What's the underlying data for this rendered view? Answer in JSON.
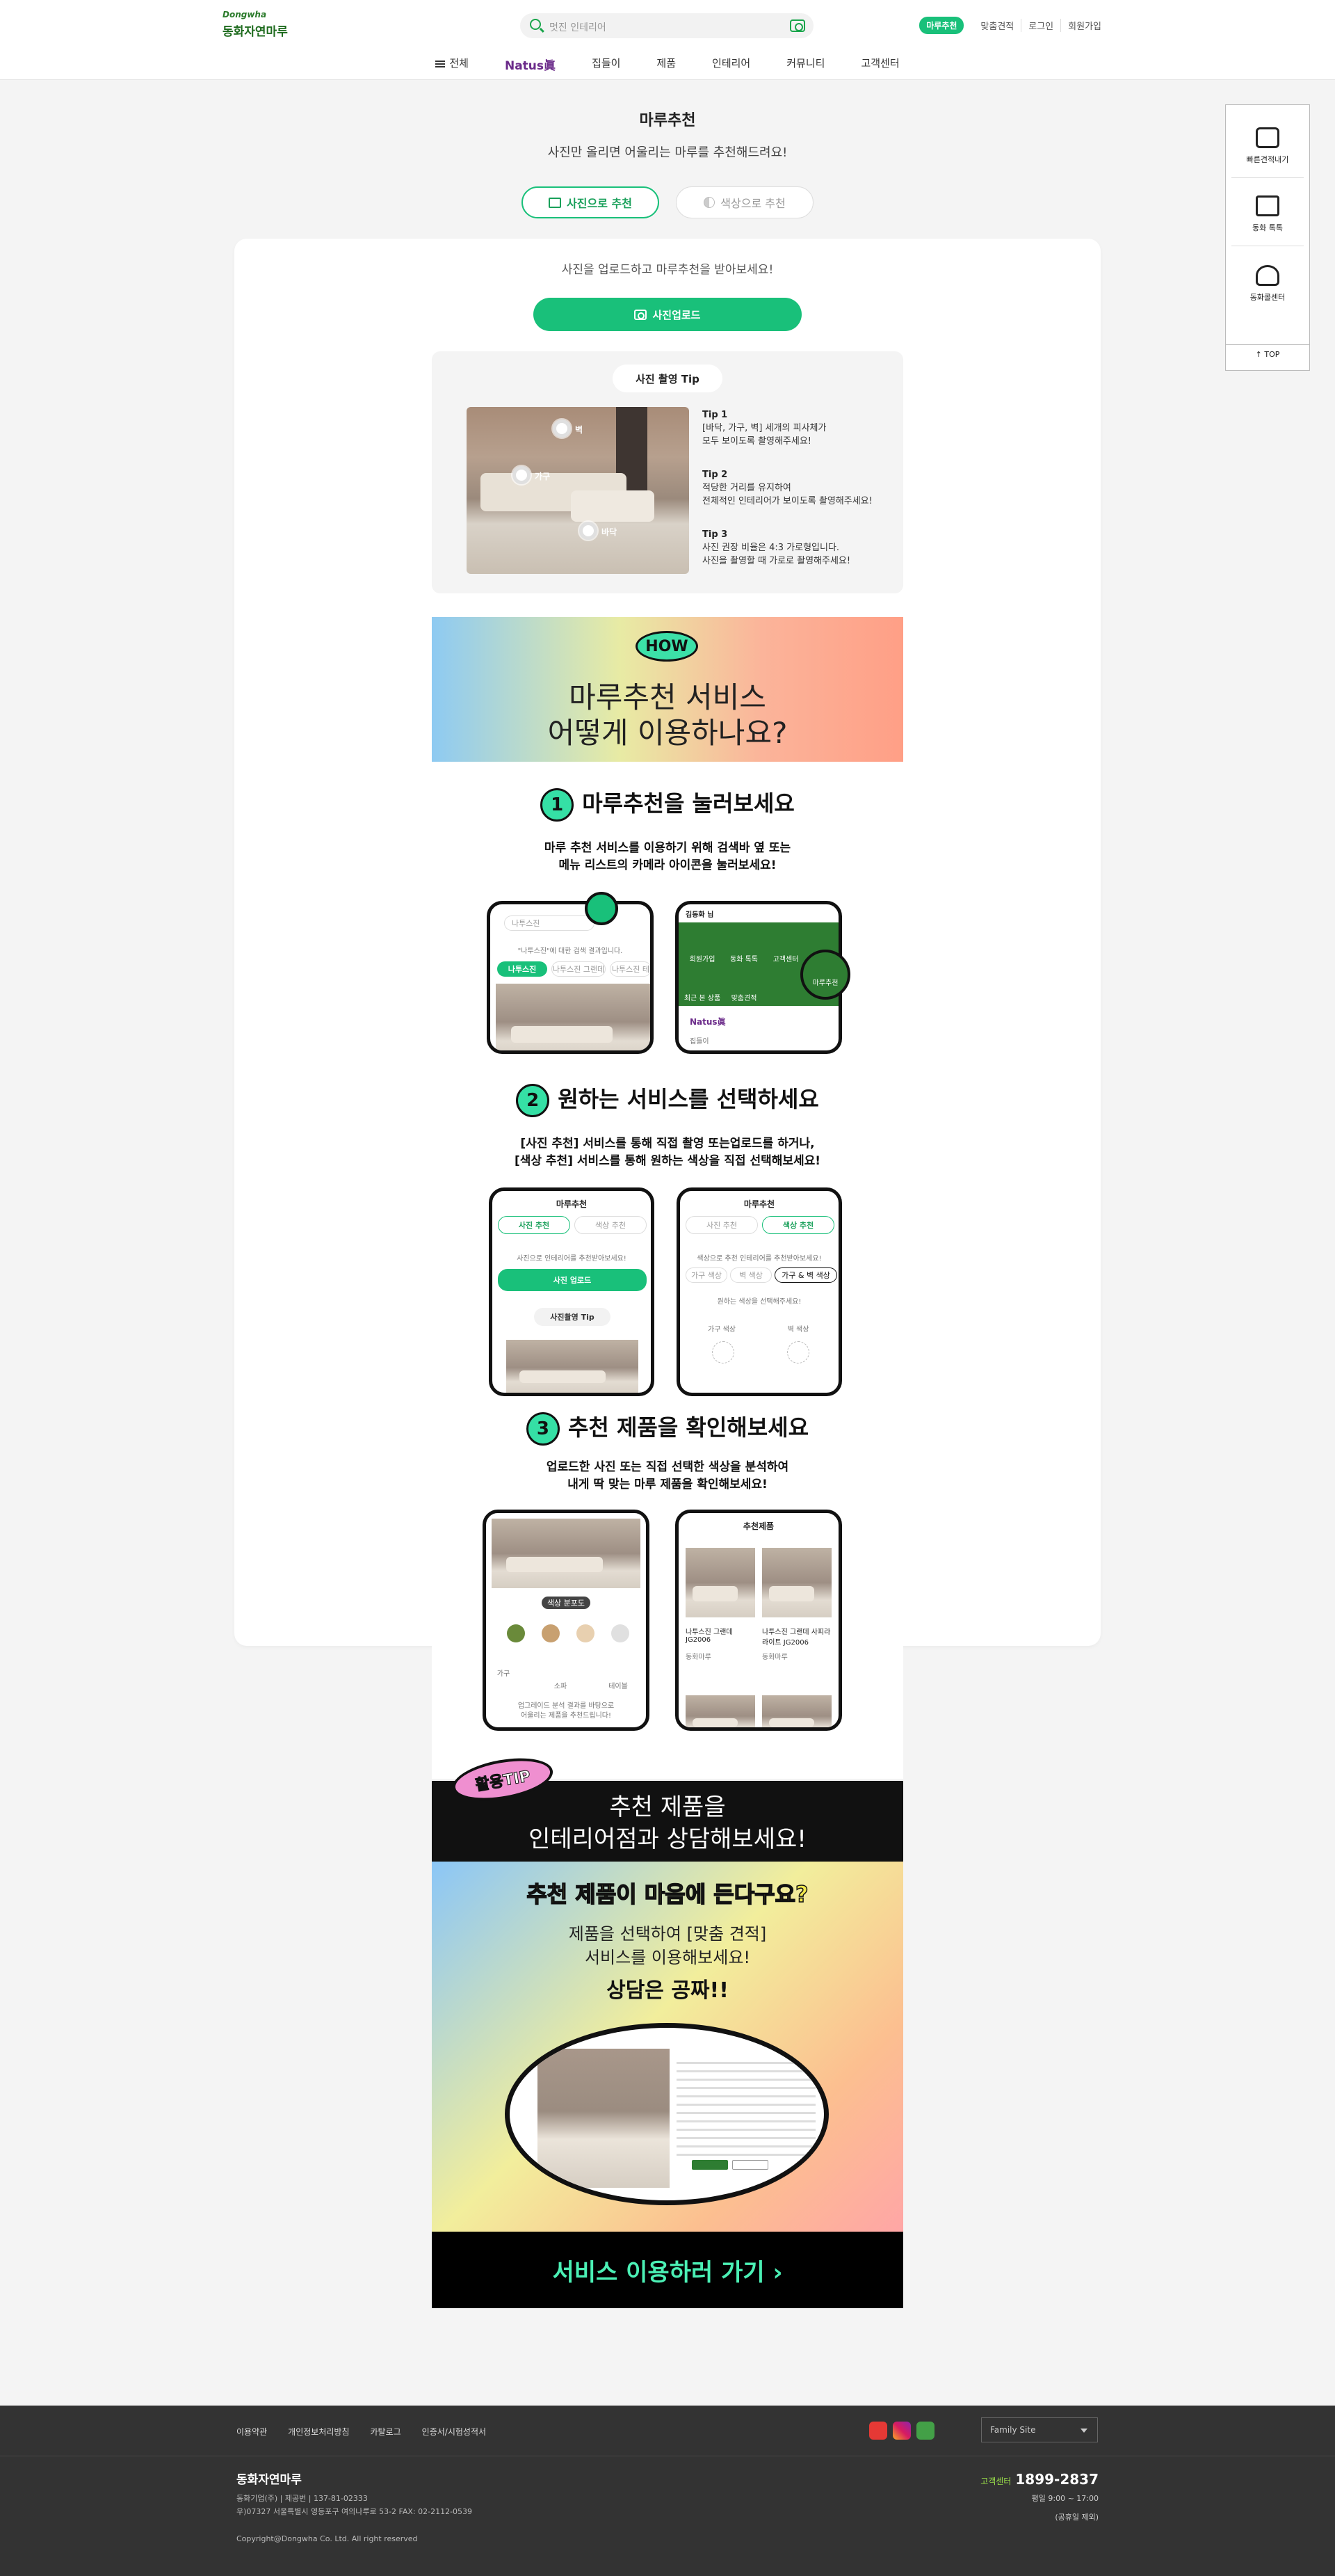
{
  "header": {
    "logo_en": "Dongwha",
    "logo_ko": "동화자연마루",
    "search_placeholder": "멋진 인테리어",
    "links": [
      "마루추천",
      "맞춤견적",
      "로그인",
      "회원가입"
    ],
    "gnb": [
      "전체",
      "Natus眞",
      "집들이",
      "제품",
      "인테리어",
      "커뮤니티",
      "고객센터"
    ]
  },
  "page": {
    "title": "마루추천",
    "subtitle": "사진만 올리면 어울리는 마루를 추천해드려요!",
    "tabs": [
      "사진으로 추천",
      "색상으로 추천"
    ],
    "upload_hint": "사진을 업로드하고 마루추천을 받아보세요!",
    "upload_button": "사진업로드",
    "tip_title": "사진 촬영 Tip",
    "markers": [
      "벽",
      "가구",
      "바닥"
    ],
    "tips": [
      {
        "title": "Tip 1",
        "lines": [
          "[바닥, 가구, 벽] 세개의 피사체가",
          "모두 보이도록 촬영해주세요!"
        ]
      },
      {
        "title": "Tip 2",
        "lines": [
          "적당한 거리를 유지하여",
          "전체적인 인테리어가 보이도록 촬영해주세요!"
        ]
      },
      {
        "title": "Tip 3",
        "lines": [
          "사진 권장 비율은 4:3 가로형입니다.",
          "사진을 촬영할 때 가로로 촬영해주세요!"
        ]
      }
    ]
  },
  "guide": {
    "how_badge": "HOW",
    "how_l1": "마루추천 서비스",
    "how_l2": "어떻게 이용하나요?",
    "steps": [
      {
        "num": "1",
        "title": "마루추천을 눌러보세요",
        "d1": "마루 추천 서비스를 이용하기 위해 검색바 옆 또는",
        "d2": "메뉴 리스트의 카메라 아이콘을 눌러보세요!"
      },
      {
        "num": "2",
        "title": "원하는 서비스를 선택하세요",
        "d1": "[사진 추천] 서비스를 통해 직접 촬영 또는업로드를 하거나,",
        "d2": "[색상 추천] 서비스를 통해 원하는 색상을 직접 선택해보세요!"
      },
      {
        "num": "3",
        "title": "추천 제품을 확인해보세요",
        "d1": "업로드한 사진 또는 직접 선택한 색상을 분석하여",
        "d2": "내게 딱 맞는 마루 제품을 확인해보세요!"
      }
    ],
    "phone1": {
      "search": "나투스진",
      "result": "\"나투스진\"에 대한 검색 결과입니다.",
      "chips": [
        "나투스진",
        "나투스진 그랜데",
        "나투스진 테"
      ]
    },
    "phone2": {
      "user": "김동화 님",
      "menu": [
        "회원가입",
        "동화 톡톡",
        "고객센터",
        "최근 본 상품",
        "맞춤견적",
        "마루추천"
      ],
      "cam_label": "마루추천",
      "natus": "Natus眞",
      "sub": "집들이"
    },
    "phone3": {
      "title": "마루추천",
      "tabs": [
        "사진 추천",
        "색상 추천"
      ],
      "hint": "사진으로 인테리어를 추천받아보세요!",
      "btn": "사진 업로드",
      "tip": "사진촬영 Tip"
    },
    "phone4": {
      "title": "마루추천",
      "tabs": [
        "사진 추천",
        "색상 추천"
      ],
      "hint": "색상으로 추천 인테리어를 추천받아보세요!",
      "chips": [
        "가구 색상",
        "벽 색상",
        "가구 & 벽 색상"
      ],
      "hint2": "원하는 색상을 선택해주세요!",
      "labels": [
        "가구 색상",
        "벽 색상"
      ]
    },
    "phone5": {
      "pill": "색상 분포도",
      "furn": "가구",
      "sofa": "소파",
      "wall": "테이블",
      "note1": "업그레이드 분석 결과를 바탕으로",
      "note2": "어울리는 제품을 추천드립니다!"
    },
    "phone6": {
      "title": "추천제품",
      "p1": "나투스진 그랜데 JG2006",
      "p2": "나투스진 그랜데 사피라 라이트 JG2006",
      "brand": "동화마루"
    }
  },
  "tip_section": {
    "badge": "활용TIP",
    "bar_l1": "추천 제품을",
    "bar_l2": "인테리어점과 상담해보세요!",
    "question": "추천 제품이 마음에 든다구요?",
    "s1": "제품을 선택하여 [맞춤 견적]",
    "s2": "서비스를 이용해보세요!",
    "free": "상담은 공짜!!",
    "cta": "서비스 이용하러 가기 ›"
  },
  "float": {
    "items": [
      "빠른견적내기",
      "동화 톡톡",
      "동화콜센터"
    ],
    "top": "TOP"
  },
  "footer": {
    "nav": [
      "이용약관",
      "개인정보처리방침",
      "카탈로그",
      "인증서/시험성적서"
    ],
    "family": "Family Site",
    "name": "동화자연마루",
    "info1": "동화기업(주) | 제공번 | 137-81-02333",
    "info2": "우)07327 서울특별시 영등포구 여의나루로 53-2     FAX: 02-2112-0539",
    "copy": "Copyright@Dongwha Co. Ltd. All right reserved",
    "cs_label": "고객센터",
    "cs_num": "1899-2837",
    "hours": "평일 9:00 ~ 17:00",
    "holiday": "(공휴일 제외)"
  }
}
